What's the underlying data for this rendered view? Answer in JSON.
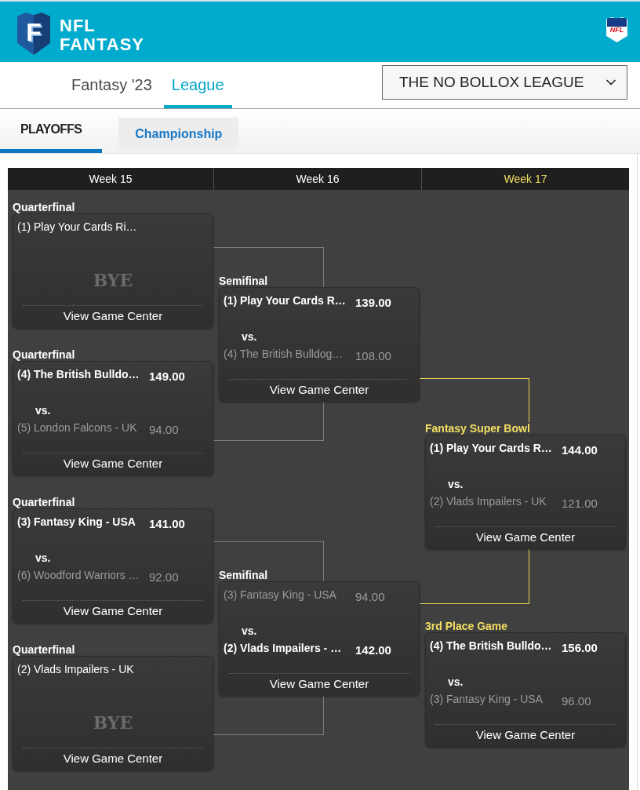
{
  "brand": {
    "mark": "F",
    "wordmark": [
      "NFL",
      "FANTASY"
    ],
    "shield_text": "NFL"
  },
  "nav": {
    "tabs": [
      {
        "label": "Fantasy '23",
        "selected": false
      },
      {
        "label": "League",
        "selected": true
      }
    ],
    "league_select": {
      "value": "THE NO BOLLOX LEAGUE"
    }
  },
  "section_tabs": [
    {
      "label": "PLAYOFFS",
      "selected": true
    },
    {
      "label": "Championship",
      "selected": false
    }
  ],
  "bracket": {
    "weeks": [
      {
        "label": "Week 15",
        "current": false,
        "matchups": [
          {
            "title": "Quarterfinal",
            "kind": "bye",
            "teams": [
              {
                "name": "(1) Play Your Cards Ri…"
              }
            ],
            "bye_label": "BYE",
            "link": "View Game Center"
          },
          {
            "title": "Quarterfinal",
            "kind": "game",
            "teams": [
              {
                "name": "(4) The British Bulldo…",
                "score": "149.00",
                "winner": true
              },
              {
                "name": "(5) London Falcons - UK",
                "score": "94.00",
                "winner": false
              }
            ],
            "vs": "vs.",
            "link": "View Game Center"
          },
          {
            "title": "Quarterfinal",
            "kind": "game",
            "teams": [
              {
                "name": "(3) Fantasy King - USA",
                "score": "141.00",
                "winner": true
              },
              {
                "name": "(6) Woodford Warriors …",
                "score": "92.00",
                "winner": false
              }
            ],
            "vs": "vs.",
            "link": "View Game Center"
          },
          {
            "title": "Quarterfinal",
            "kind": "bye",
            "teams": [
              {
                "name": "(2) Vlads Impailers - UK"
              }
            ],
            "bye_label": "BYE",
            "link": "View Game Center"
          }
        ]
      },
      {
        "label": "Week 16",
        "current": false,
        "matchups": [
          {
            "title": "Semifinal",
            "kind": "game",
            "teams": [
              {
                "name": "(1) Play Your Cards R…",
                "score": "139.00",
                "winner": true
              },
              {
                "name": "(4) The British Bulldog…",
                "score": "108.00",
                "winner": false
              }
            ],
            "vs": "vs.",
            "link": "View Game Center"
          },
          {
            "title": "Semifinal",
            "kind": "game",
            "teams": [
              {
                "name": "(3) Fantasy King - USA",
                "score": "94.00",
                "winner": false
              },
              {
                "name": "(2) Vlads Impailers - …",
                "score": "142.00",
                "winner": true
              }
            ],
            "vs": "vs.",
            "link": "View Game Center"
          }
        ]
      },
      {
        "label": "Week 17",
        "current": true,
        "matchups": [
          {
            "title": "Fantasy Super Bowl",
            "kind": "game",
            "teams": [
              {
                "name": "(1) Play Your Cards R…",
                "score": "144.00",
                "winner": true
              },
              {
                "name": "(2) Vlads Impailers - UK",
                "score": "121.00",
                "winner": false
              }
            ],
            "vs": "vs.",
            "link": "View Game Center"
          },
          {
            "title": "3rd Place Game",
            "kind": "game",
            "teams": [
              {
                "name": "(4) The British Bulldo…",
                "score": "156.00",
                "winner": true
              },
              {
                "name": "(3) Fantasy King - USA",
                "score": "96.00",
                "winner": false
              }
            ],
            "vs": "vs.",
            "link": "View Game Center"
          }
        ]
      }
    ]
  }
}
